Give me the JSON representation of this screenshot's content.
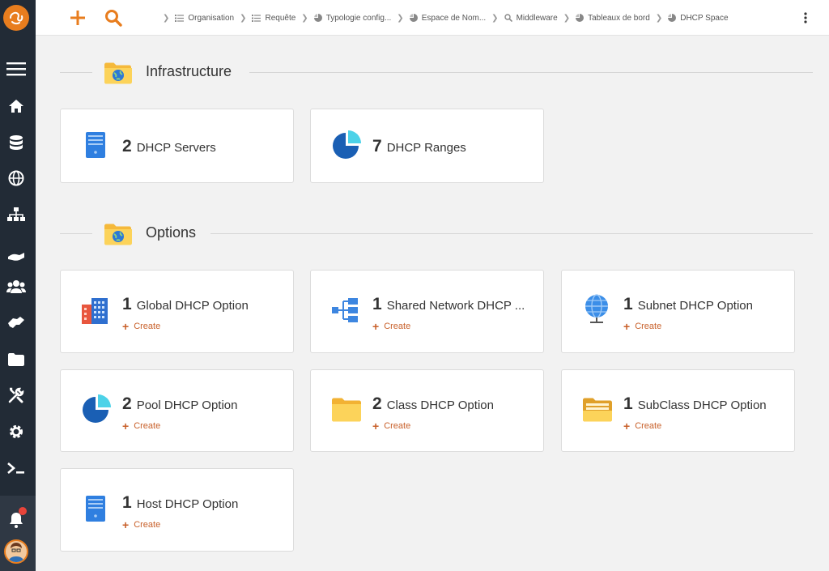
{
  "topbar": {
    "add_icon": "plus-icon",
    "search_icon": "search-icon",
    "breadcrumbs": [
      {
        "label": "Organisation",
        "icon": "list-icon"
      },
      {
        "label": "Requête",
        "icon": "list-icon"
      },
      {
        "label": "Typologie config...",
        "icon": "pie-icon"
      },
      {
        "label": "Espace de Nom...",
        "icon": "pie-icon"
      },
      {
        "label": "Middleware",
        "icon": "search-icon"
      },
      {
        "label": "Tableaux de bord",
        "icon": "pie-icon"
      },
      {
        "label": "DHCP Space",
        "icon": "pie-icon"
      }
    ]
  },
  "sidebar": {
    "items": [
      "menu-icon",
      "home-icon",
      "database-icon",
      "globe-icon",
      "sitemap-icon",
      "handshake-icon",
      "users-icon",
      "hand-icon",
      "folder-icon",
      "tools-icon",
      "gear-icon",
      "terminal-icon"
    ],
    "bell_icon": "bell-icon"
  },
  "sections": [
    {
      "title": "Infrastructure",
      "cards": [
        {
          "count": "2",
          "label": "DHCP Servers",
          "icon": "server-icon"
        },
        {
          "count": "7",
          "label": "DHCP Ranges",
          "icon": "pie-chart-icon"
        }
      ]
    },
    {
      "title": "Options",
      "cards": [
        {
          "count": "1",
          "label": "Global DHCP Option",
          "icon": "building-icon",
          "action": "Create"
        },
        {
          "count": "1",
          "label": "Shared Network DHCP ...",
          "icon": "tree-icon",
          "action": "Create"
        },
        {
          "count": "1",
          "label": "Subnet DHCP Option",
          "icon": "globe-network-icon",
          "action": "Create"
        },
        {
          "count": "2",
          "label": "Pool DHCP Option",
          "icon": "pie-chart-icon",
          "action": "Create"
        },
        {
          "count": "2",
          "label": "Class DHCP Option",
          "icon": "folder-icon",
          "action": "Create"
        },
        {
          "count": "1",
          "label": "SubClass DHCP Option",
          "icon": "folder-open-icon",
          "action": "Create"
        },
        {
          "count": "1",
          "label": "Host DHCP Option",
          "icon": "server-icon",
          "action": "Create"
        }
      ]
    }
  ],
  "colors": {
    "accent": "#e87d1e",
    "sidebar": "#222b36",
    "create": "#c8602a",
    "icon_blue": "#1e6fd9"
  }
}
